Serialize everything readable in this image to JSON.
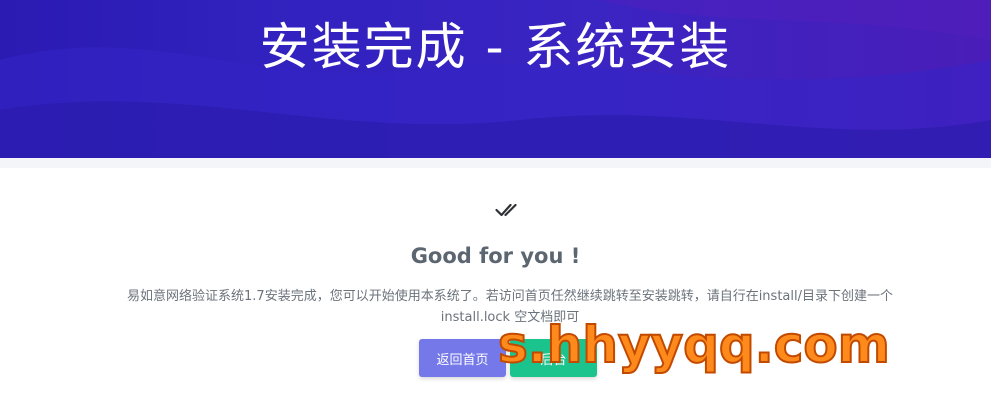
{
  "header": {
    "title": "安装完成 - 系统安装"
  },
  "result": {
    "icon": "double-check-icon",
    "headline": "Good for you !",
    "message": "易如意网络验证系统1.7安装完成，您可以开始使用本系统了。若访问首页任然继续跳转至安装跳转，请自行在install/目录下创建一个 install.lock 空文档即可"
  },
  "buttons": {
    "home_label": "返回首页",
    "admin_label": "后台"
  },
  "watermark": {
    "text": "s.hhyyqq.com"
  },
  "colors": {
    "hero_start": "#2b1bb3",
    "hero_end": "#4a1db8",
    "home_button": "#7478e8",
    "admin_button": "#1bc48c",
    "watermark_fill": "#ff8a1c",
    "watermark_stroke": "#c24a00"
  }
}
